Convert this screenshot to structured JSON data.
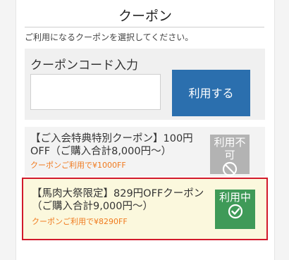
{
  "header": {
    "title": "クーポン"
  },
  "instruction": "ご利用になるクーポンを選択してください。",
  "code_entry": {
    "label": "クーポンコード入力",
    "input_value": "",
    "button_label": "利用する"
  },
  "coupons": [
    {
      "name": "【ご入会特典特別クーポン】100円OFF（ご購入合計8,000円〜）",
      "note": "クーポンご利用で¥1000FF",
      "status": "利用不可",
      "status_icon": "prohibited-icon",
      "selected": false
    },
    {
      "name": "【馬肉大祭限定】829円OFFクーポン（ご購入合計9,000円〜）",
      "note": "クーポンご利用で¥8290FF",
      "status": "利用中",
      "status_icon": "check-circle-icon",
      "selected": true
    }
  ],
  "colors": {
    "primary_button": "#2b6fae",
    "active_status": "#3f9a58",
    "unavailable_status": "#b3b3b3",
    "selected_border": "#d21a2b",
    "note_text": "#f07a1e"
  }
}
